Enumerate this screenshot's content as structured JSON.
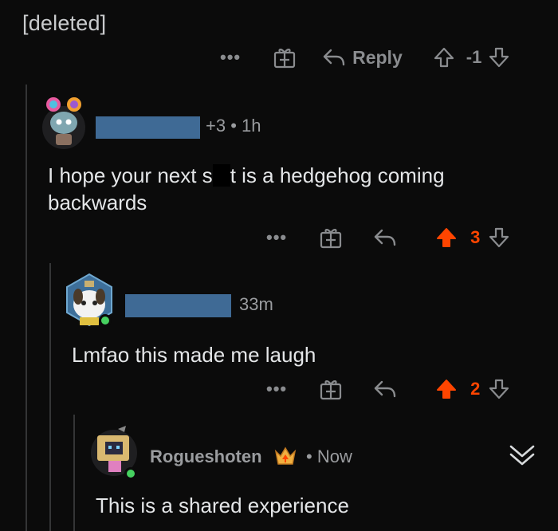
{
  "parent": {
    "author": "[deleted]",
    "reply_label": "Reply",
    "score": "-1",
    "dots": "•••"
  },
  "comment1": {
    "meta": "+3 • 1h",
    "text_part1": "I hope your next s",
    "text_part2": "t is a hedgehog coming",
    "text_line2": "backwards",
    "score": "3",
    "dots": "•••"
  },
  "comment2": {
    "meta": "33m",
    "text": "Lmfao this made me laugh",
    "score": "2",
    "dots": "•••"
  },
  "comment3": {
    "username": "Rogueshoten",
    "meta": "• Now",
    "text": "This is a shared experience"
  },
  "colors": {
    "upvote_active": "#ff4500",
    "icon_gray": "#8a8c8f",
    "redaction": "#3f6a95",
    "online": "#46d160"
  }
}
